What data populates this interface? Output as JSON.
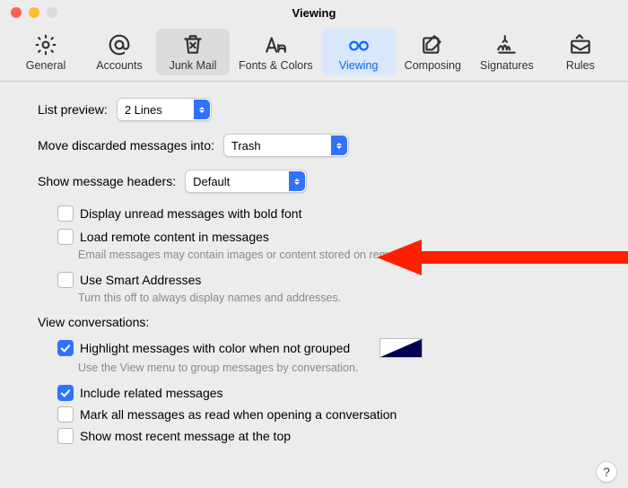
{
  "window": {
    "title": "Viewing"
  },
  "toolbar": [
    {
      "id": "general",
      "label": "General",
      "icon": "gear-icon"
    },
    {
      "id": "accounts",
      "label": "Accounts",
      "icon": "at-icon"
    },
    {
      "id": "junk",
      "label": "Junk Mail",
      "icon": "trash-x-icon",
      "selected": "gray"
    },
    {
      "id": "fonts",
      "label": "Fonts & Colors",
      "icon": "fonts-icon"
    },
    {
      "id": "viewing",
      "label": "Viewing",
      "icon": "glasses-icon",
      "selected": "blue"
    },
    {
      "id": "composing",
      "label": "Composing",
      "icon": "compose-icon"
    },
    {
      "id": "signatures",
      "label": "Signatures",
      "icon": "signature-icon"
    },
    {
      "id": "rules",
      "label": "Rules",
      "icon": "rules-icon"
    }
  ],
  "listpreview": {
    "label": "List preview:",
    "value": "2 Lines"
  },
  "movediscarded": {
    "label": "Move discarded messages into:",
    "value": "Trash"
  },
  "headers": {
    "label": "Show message headers:",
    "value": "Default"
  },
  "opts": {
    "bold": {
      "label": "Display unread messages with bold font",
      "checked": false
    },
    "remote": {
      "label": "Load remote content in messages",
      "checked": false,
      "hint": "Email messages may contain images or content stored on remote servers."
    },
    "smart": {
      "label": "Use Smart Addresses",
      "checked": false,
      "hint": "Turn this off to always display names and addresses."
    }
  },
  "conv": {
    "title": "View conversations:",
    "highlight": {
      "label": "Highlight messages with color when not grouped",
      "checked": true,
      "hint": "Use the View menu to group messages by conversation."
    },
    "related": {
      "label": "Include related messages",
      "checked": true
    },
    "markread": {
      "label": "Mark all messages as read when opening a conversation",
      "checked": false
    },
    "recent": {
      "label": "Show most recent message at the top",
      "checked": false
    }
  },
  "help": "?"
}
